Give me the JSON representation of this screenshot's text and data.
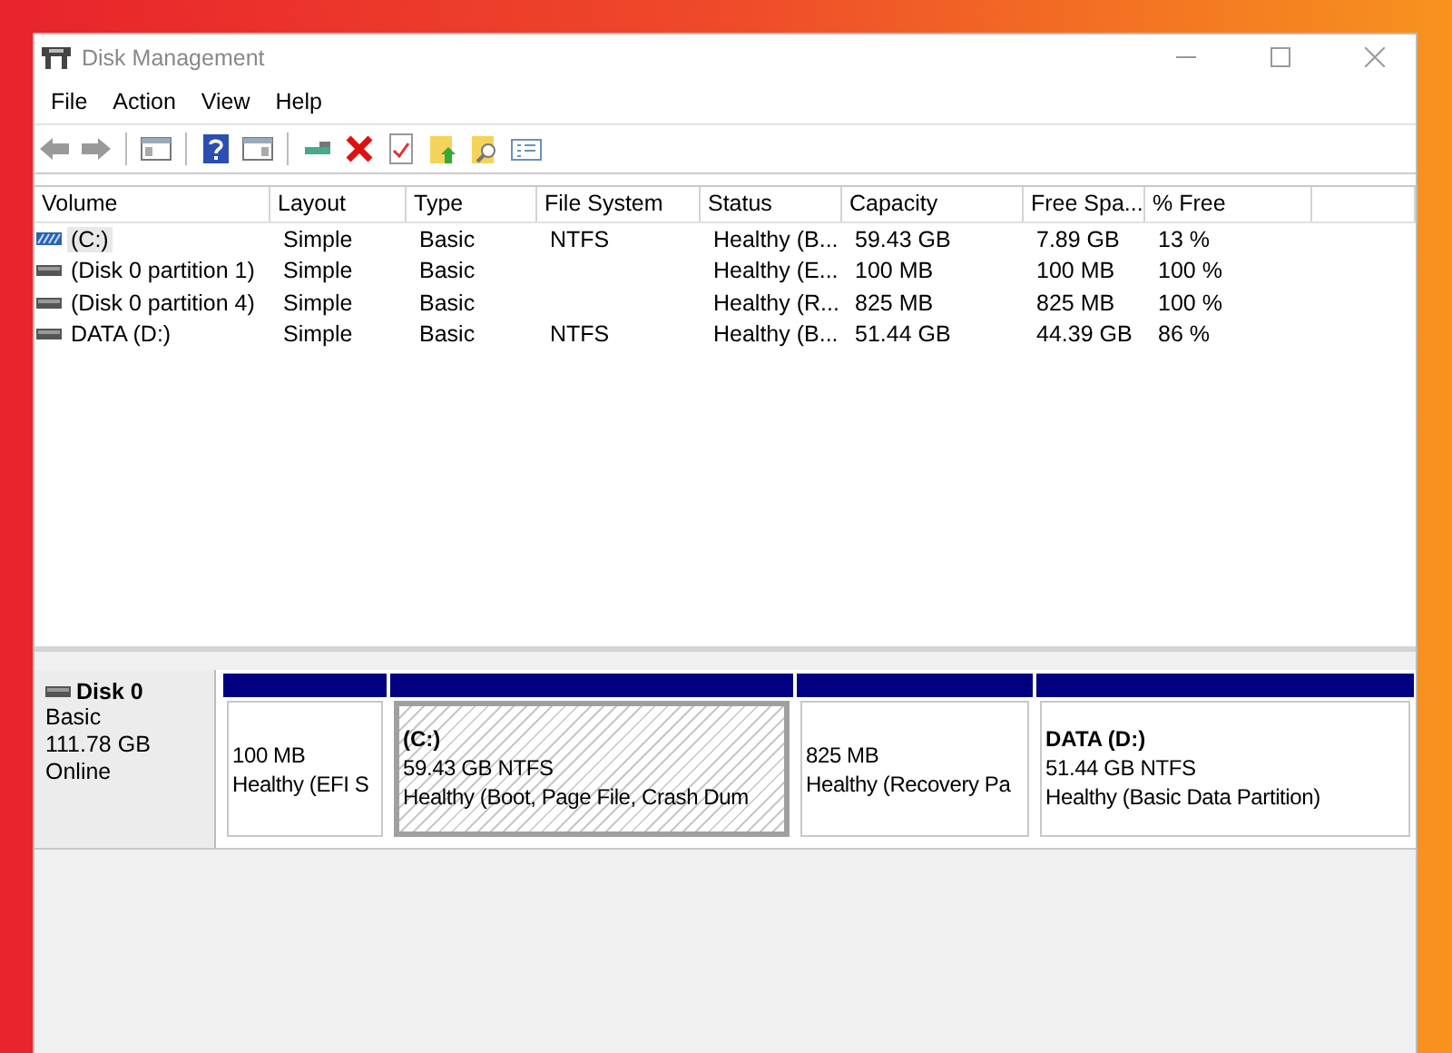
{
  "window": {
    "title": "Disk Management"
  },
  "menu": [
    "File",
    "Action",
    "View",
    "Help"
  ],
  "table": {
    "columns": [
      "Volume",
      "Layout",
      "Type",
      "File System",
      "Status",
      "Capacity",
      "Free Spa...",
      "% Free"
    ],
    "rows": [
      {
        "kind": "striped",
        "selected": true,
        "cells": [
          "(C:)",
          "Simple",
          "Basic",
          "NTFS",
          "Healthy (B...",
          "59.43 GB",
          "7.89 GB",
          "13 %"
        ]
      },
      {
        "kind": "plain",
        "selected": false,
        "cells": [
          "(Disk 0 partition 1)",
          "Simple",
          "Basic",
          "",
          "Healthy (E...",
          "100 MB",
          "100 MB",
          "100 %"
        ]
      },
      {
        "kind": "plain",
        "selected": false,
        "cells": [
          "(Disk 0 partition 4)",
          "Simple",
          "Basic",
          "",
          "Healthy (R...",
          "825 MB",
          "825 MB",
          "100 %"
        ]
      },
      {
        "kind": "plain",
        "selected": false,
        "cells": [
          "DATA (D:)",
          "Simple",
          "Basic",
          "NTFS",
          "Healthy (B...",
          "51.44 GB",
          "44.39 GB",
          "86 %"
        ]
      }
    ]
  },
  "disk": {
    "name": "Disk 0",
    "type": "Basic",
    "size": "111.78 GB",
    "state": "Online",
    "partitions": [
      {
        "selected": false,
        "size": "100 MB",
        "status": "Healthy (EFI S"
      },
      {
        "selected": true,
        "label": "(C:)",
        "size": "59.43 GB NTFS",
        "status": "Healthy (Boot, Page File, Crash Dum"
      },
      {
        "selected": false,
        "size": "825 MB",
        "status": "Healthy (Recovery Pa"
      },
      {
        "selected": false,
        "label": "DATA  (D:)",
        "size": "51.44 GB NTFS",
        "status": "Healthy (Basic Data Partition)"
      }
    ]
  }
}
